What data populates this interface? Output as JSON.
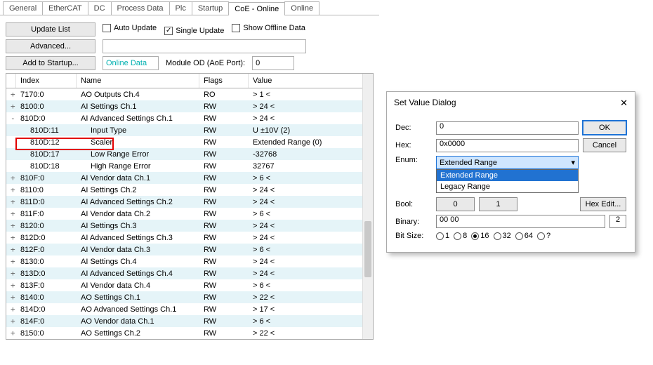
{
  "tabs": [
    "General",
    "EtherCAT",
    "DC",
    "Process Data",
    "Plc",
    "Startup",
    "CoE - Online",
    "Online"
  ],
  "activeTab": 6,
  "toolbar": {
    "updateList": "Update List",
    "advanced": "Advanced...",
    "addStartup": "Add to Startup...",
    "autoUpdate": "Auto Update",
    "singleUpdate": "Single Update",
    "showOffline": "Show Offline Data",
    "onlineData": "Online Data",
    "moduleOd": "Module OD (AoE Port):",
    "moduleOdVal": "0"
  },
  "columns": {
    "index": "Index",
    "name": "Name",
    "flags": "Flags",
    "value": "Value"
  },
  "rows": [
    {
      "exp": "+",
      "idx": "7170:0",
      "name": "AO Outputs Ch.4",
      "flags": "RO",
      "val": "> 1 <"
    },
    {
      "exp": "+",
      "idx": "8100:0",
      "name": "AI Settings Ch.1",
      "flags": "RW",
      "val": "> 24 <"
    },
    {
      "exp": "-",
      "idx": "810D:0",
      "name": "AI Advanced Settings Ch.1",
      "flags": "RW",
      "val": "> 24 <"
    },
    {
      "exp": "",
      "idx": "810D:11",
      "name": "Input Type",
      "flags": "RW",
      "val": "U ±10V (2)",
      "child": true
    },
    {
      "exp": "",
      "idx": "810D:12",
      "name": "Scaler",
      "flags": "RW",
      "val": "Extended Range (0)",
      "child": true,
      "hl": true
    },
    {
      "exp": "",
      "idx": "810D:17",
      "name": "Low Range Error",
      "flags": "RW",
      "val": "-32768",
      "child": true
    },
    {
      "exp": "",
      "idx": "810D:18",
      "name": "High Range Error",
      "flags": "RW",
      "val": "32767",
      "child": true
    },
    {
      "exp": "+",
      "idx": "810F:0",
      "name": "AI Vendor data Ch.1",
      "flags": "RW",
      "val": "> 6 <"
    },
    {
      "exp": "+",
      "idx": "8110:0",
      "name": "AI Settings Ch.2",
      "flags": "RW",
      "val": "> 24 <"
    },
    {
      "exp": "+",
      "idx": "811D:0",
      "name": "AI Advanced Settings Ch.2",
      "flags": "RW",
      "val": "> 24 <"
    },
    {
      "exp": "+",
      "idx": "811F:0",
      "name": "AI Vendor data Ch.2",
      "flags": "RW",
      "val": "> 6 <"
    },
    {
      "exp": "+",
      "idx": "8120:0",
      "name": "AI Settings Ch.3",
      "flags": "RW",
      "val": "> 24 <"
    },
    {
      "exp": "+",
      "idx": "812D:0",
      "name": "AI Advanced Settings Ch.3",
      "flags": "RW",
      "val": "> 24 <"
    },
    {
      "exp": "+",
      "idx": "812F:0",
      "name": "AI Vendor data Ch.3",
      "flags": "RW",
      "val": "> 6 <"
    },
    {
      "exp": "+",
      "idx": "8130:0",
      "name": "AI Settings Ch.4",
      "flags": "RW",
      "val": "> 24 <"
    },
    {
      "exp": "+",
      "idx": "813D:0",
      "name": "AI Advanced Settings Ch.4",
      "flags": "RW",
      "val": "> 24 <"
    },
    {
      "exp": "+",
      "idx": "813F:0",
      "name": "AI Vendor data Ch.4",
      "flags": "RW",
      "val": "> 6 <"
    },
    {
      "exp": "+",
      "idx": "8140:0",
      "name": "AO Settings Ch.1",
      "flags": "RW",
      "val": "> 22 <"
    },
    {
      "exp": "+",
      "idx": "814D:0",
      "name": "AO Advanced Settings Ch.1",
      "flags": "RW",
      "val": "> 17 <"
    },
    {
      "exp": "+",
      "idx": "814F:0",
      "name": "AO Vendor data Ch.1",
      "flags": "RW",
      "val": "> 6 <"
    },
    {
      "exp": "+",
      "idx": "8150:0",
      "name": "AO Settings Ch.2",
      "flags": "RW",
      "val": "> 22 <"
    }
  ],
  "dialog": {
    "title": "Set Value Dialog",
    "dec": "Dec:",
    "decVal": "0",
    "hex": "Hex:",
    "hexVal": "0x0000",
    "enum": "Enum:",
    "enumSel": "Extended Range",
    "enumOptions": [
      "Extended Range",
      "Legacy Range"
    ],
    "bool": "Bool:",
    "bool0": "0",
    "bool1": "1",
    "hexEdit": "Hex Edit...",
    "binary": "Binary:",
    "binaryVal": "00 00",
    "binaryLen": "2",
    "bitSize": "Bit Size:",
    "bits": [
      "1",
      "8",
      "16",
      "32",
      "64",
      "?"
    ],
    "bitsSel": 2,
    "ok": "OK",
    "cancel": "Cancel"
  }
}
